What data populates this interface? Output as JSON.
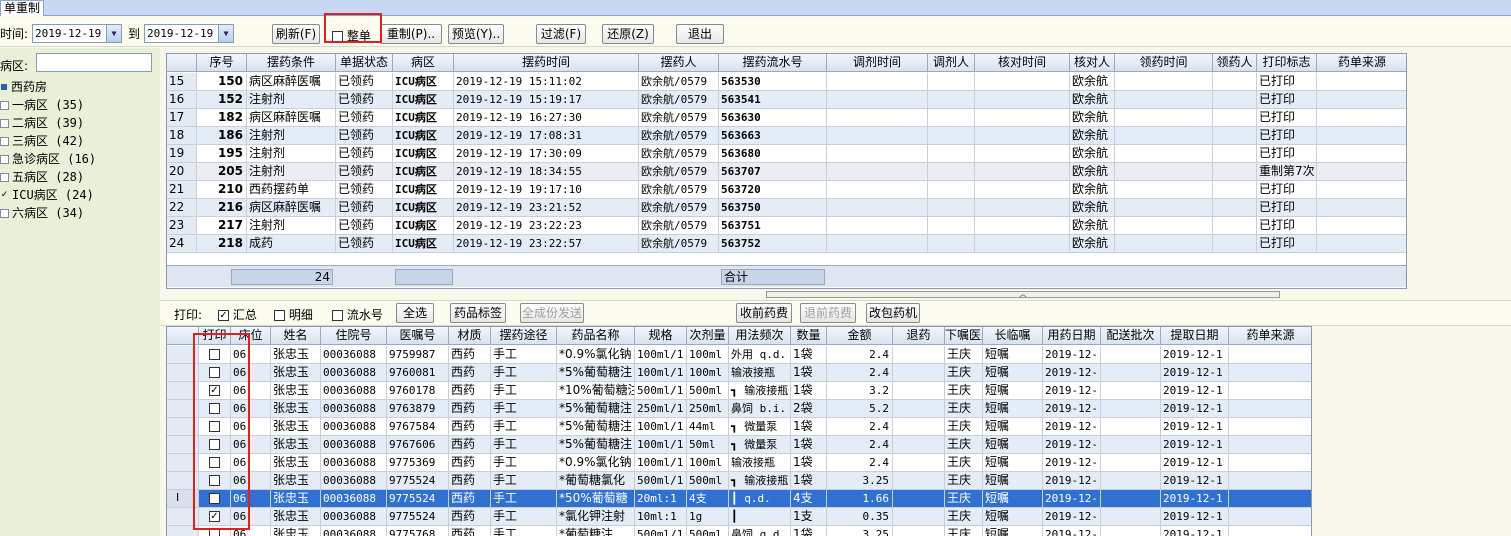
{
  "window": {
    "title": "单重制"
  },
  "toolbar": {
    "time_label": "时间:",
    "date_from": "2019-12-19",
    "to_label": "到",
    "date_to": "2019-12-19",
    "refresh": "刷新(F)",
    "whole_label": "整单",
    "whole_checked": false,
    "reprint": "重制(P)..",
    "preview": "预览(Y)..",
    "filter": "过滤(F)",
    "restore": "还原(Z)",
    "exit": "退出"
  },
  "left": {
    "ward_label": "病区:",
    "ward_value": "",
    "root": "西药房",
    "items": [
      {
        "label": "一病区 (35)",
        "checked": false
      },
      {
        "label": "二病区 (39)",
        "checked": false
      },
      {
        "label": "三病区 (42)",
        "checked": false
      },
      {
        "label": "急诊病区 (16)",
        "checked": false
      },
      {
        "label": "五病区 (28)",
        "checked": false
      },
      {
        "label": "ICU病区 (24)",
        "checked": true
      },
      {
        "label": "六病区 (34)",
        "checked": false
      }
    ]
  },
  "top_grid": {
    "headers": [
      "序号",
      "摆药条件",
      "单据状态",
      "病区",
      "摆药时间",
      "摆药人",
      "摆药流水号",
      "调剂时间",
      "调剂人",
      "核对时间",
      "核对人",
      "领药时间",
      "领药人",
      "打印标志",
      "药单来源"
    ],
    "rows": [
      {
        "idx": "15",
        "seq": "150",
        "cond": "病区麻醉医嘱",
        "status": "已领药",
        "ward": "ICU病区",
        "time": "2019-12-19 15:11:02",
        "person": "欧余航/0579",
        "serial": "563530",
        "checker": "欧余航",
        "flag": "已打印"
      },
      {
        "idx": "16",
        "seq": "152",
        "cond": "注射剂",
        "status": "已领药",
        "ward": "ICU病区",
        "time": "2019-12-19 15:19:17",
        "person": "欧余航/0579",
        "serial": "563541",
        "checker": "欧余航",
        "flag": "已打印"
      },
      {
        "idx": "17",
        "seq": "182",
        "cond": "病区麻醉医嘱",
        "status": "已领药",
        "ward": "ICU病区",
        "time": "2019-12-19 16:27:30",
        "person": "欧余航/0579",
        "serial": "563630",
        "checker": "欧余航",
        "flag": "已打印"
      },
      {
        "idx": "18",
        "seq": "186",
        "cond": "注射剂",
        "status": "已领药",
        "ward": "ICU病区",
        "time": "2019-12-19 17:08:31",
        "person": "欧余航/0579",
        "serial": "563663",
        "checker": "欧余航",
        "flag": "已打印"
      },
      {
        "idx": "19",
        "seq": "195",
        "cond": "注射剂",
        "status": "已领药",
        "ward": "ICU病区",
        "time": "2019-12-19 17:30:09",
        "person": "欧余航/0579",
        "serial": "563680",
        "checker": "欧余航",
        "flag": "已打印"
      },
      {
        "idx": "20",
        "seq": "205",
        "cond": "注射剂",
        "status": "已领药",
        "ward": "ICU病区",
        "time": "2019-12-19 18:34:55",
        "person": "欧余航/0579",
        "serial": "563707",
        "checker": "欧余航",
        "flag": "重制第7次"
      },
      {
        "idx": "21",
        "seq": "210",
        "cond": "西药摆药单",
        "status": "已领药",
        "ward": "ICU病区",
        "time": "2019-12-19 19:17:10",
        "person": "欧余航/0579",
        "serial": "563720",
        "checker": "欧余航",
        "flag": "已打印"
      },
      {
        "idx": "22",
        "seq": "216",
        "cond": "病区麻醉医嘱",
        "status": "已领药",
        "ward": "ICU病区",
        "time": "2019-12-19 23:21:52",
        "person": "欧余航/0579",
        "serial": "563750",
        "checker": "欧余航",
        "flag": "已打印"
      },
      {
        "idx": "23",
        "seq": "217",
        "cond": "注射剂",
        "status": "已领药",
        "ward": "ICU病区",
        "time": "2019-12-19 23:22:23",
        "person": "欧余航/0579",
        "serial": "563751",
        "checker": "欧余航",
        "flag": "已打印"
      },
      {
        "idx": "24",
        "seq": "218",
        "cond": "成药",
        "status": "已领药",
        "ward": "ICU病区",
        "time": "2019-12-19 23:22:57",
        "person": "欧余航/0579",
        "serial": "563752",
        "checker": "欧余航",
        "flag": "已打印"
      }
    ],
    "footer_count": "24",
    "footer_total": "合计"
  },
  "printbar": {
    "print_label": "打印:",
    "summary": "汇总",
    "summary_checked": true,
    "detail": "明细",
    "detail_checked": false,
    "serial": "流水号",
    "serial_checked": false,
    "select_all": "全选",
    "drug_label": "药品标签",
    "dispense_all": "全成份发送",
    "charge": "收前药费",
    "refund": "退前药费",
    "repack": "改包药机"
  },
  "bottom_grid": {
    "headers": [
      "打印",
      "床位",
      "姓名",
      "住院号",
      "医嘱号",
      "材质",
      "摆药途径",
      "药品名称",
      "规格",
      "次剂量",
      "用法频次",
      "数量",
      "金额",
      "退药",
      "下嘱医生",
      "长临嘱",
      "用药日期",
      "配送批次",
      "提取日期",
      "药单来源"
    ],
    "rows": [
      {
        "checked": false,
        "bed": "06",
        "name": "张忠玉",
        "inpatient": "00036088",
        "order": "9759987",
        "material": "西药",
        "route": "手工",
        "drug": "*0.9%氯化钠",
        "spec": "100ml/1",
        "dose": "100ml",
        "freq": "外用 q.d.",
        "qty": "1袋",
        "amount": "2.4",
        "doctor": "王庆",
        "type": "短嘱",
        "use_date": "2019-12-",
        "fetch_date": "2019-12-1"
      },
      {
        "checked": false,
        "bed": "06",
        "name": "张忠玉",
        "inpatient": "00036088",
        "order": "9760081",
        "material": "西药",
        "route": "手工",
        "drug": "*5%葡萄糖注",
        "spec": "100ml/1",
        "dose": "100ml",
        "freq": "输液接瓶",
        "qty": "1袋",
        "amount": "2.4",
        "doctor": "王庆",
        "type": "短嘱",
        "use_date": "2019-12-",
        "fetch_date": "2019-12-1"
      },
      {
        "checked": true,
        "bed": "06",
        "name": "张忠玉",
        "inpatient": "00036088",
        "order": "9760178",
        "material": "西药",
        "route": "手工",
        "drug": "*10%葡萄糖注",
        "spec": "500ml/1",
        "dose": "500ml",
        "freq": "┓ 输液接瓶",
        "qty": "1袋",
        "amount": "3.2",
        "doctor": "王庆",
        "type": "短嘱",
        "use_date": "2019-12-",
        "fetch_date": "2019-12-1"
      },
      {
        "checked": false,
        "bed": "06",
        "name": "张忠玉",
        "inpatient": "00036088",
        "order": "9763879",
        "material": "西药",
        "route": "手工",
        "drug": "*5%葡萄糖注",
        "spec": "250ml/1",
        "dose": "250ml",
        "freq": "鼻饲 b.i.",
        "qty": "2袋",
        "amount": "5.2",
        "doctor": "王庆",
        "type": "短嘱",
        "use_date": "2019-12-",
        "fetch_date": "2019-12-1"
      },
      {
        "checked": false,
        "bed": "06",
        "name": "张忠玉",
        "inpatient": "00036088",
        "order": "9767584",
        "material": "西药",
        "route": "手工",
        "drug": "*5%葡萄糖注",
        "spec": "100ml/1",
        "dose": "44ml",
        "freq": "┓ 微量泵",
        "qty": "1袋",
        "amount": "2.4",
        "doctor": "王庆",
        "type": "短嘱",
        "use_date": "2019-12-",
        "fetch_date": "2019-12-1"
      },
      {
        "checked": false,
        "bed": "06",
        "name": "张忠玉",
        "inpatient": "00036088",
        "order": "9767606",
        "material": "西药",
        "route": "手工",
        "drug": "*5%葡萄糖注",
        "spec": "100ml/1",
        "dose": "50ml",
        "freq": "┓ 微量泵",
        "qty": "1袋",
        "amount": "2.4",
        "doctor": "王庆",
        "type": "短嘱",
        "use_date": "2019-12-",
        "fetch_date": "2019-12-1"
      },
      {
        "checked": false,
        "bed": "06",
        "name": "张忠玉",
        "inpatient": "00036088",
        "order": "9775369",
        "material": "西药",
        "route": "手工",
        "drug": "*0.9%氯化钠",
        "spec": "100ml/1",
        "dose": "100ml",
        "freq": "输液接瓶",
        "qty": "1袋",
        "amount": "2.4",
        "doctor": "王庆",
        "type": "短嘱",
        "use_date": "2019-12-",
        "fetch_date": "2019-12-1"
      },
      {
        "checked": false,
        "bed": "06",
        "name": "张忠玉",
        "inpatient": "00036088",
        "order": "9775524",
        "material": "西药",
        "route": "手工",
        "drug": "*葡萄糖氯化",
        "spec": "500ml/1",
        "dose": "500ml",
        "freq": "┓ 输液接瓶",
        "qty": "1袋",
        "amount": "3.25",
        "doctor": "王庆",
        "type": "短嘱",
        "use_date": "2019-12-",
        "fetch_date": "2019-12-1"
      },
      {
        "checked": true,
        "selected": true,
        "bed": "06",
        "name": "张忠玉",
        "inpatient": "00036088",
        "order": "9775524",
        "material": "西药",
        "route": "手工",
        "drug": "*50%葡萄糖",
        "spec": "20ml:1",
        "dose": "4支",
        "freq": "┃ q.d.",
        "qty": "4支",
        "amount": "1.66",
        "doctor": "王庆",
        "type": "短嘱",
        "use_date": "2019-12-",
        "fetch_date": "2019-12-1"
      },
      {
        "checked": true,
        "bed": "06",
        "name": "张忠玉",
        "inpatient": "00036088",
        "order": "9775524",
        "material": "西药",
        "route": "手工",
        "drug": "*氯化钾注射",
        "spec": "10ml:1",
        "dose": "1g",
        "freq": "┃",
        "qty": "1支",
        "amount": "0.35",
        "doctor": "王庆",
        "type": "短嘱",
        "use_date": "2019-12-",
        "fetch_date": "2019-12-1"
      },
      {
        "checked": false,
        "bed": "06",
        "name": "张忠玉",
        "inpatient": "00036088",
        "order": "9775768",
        "material": "西药",
        "route": "手工",
        "drug": "*葡萄糖注",
        "spec": "500ml/1",
        "dose": "500ml",
        "freq": "鼻饲 q.d.",
        "qty": "1袋",
        "amount": "3.25",
        "doctor": "王庆",
        "type": "短嘱",
        "use_date": "2019-12-",
        "fetch_date": "2019-12-1"
      }
    ]
  },
  "colors": {
    "highlight": "#3070d0",
    "redbox": "#e02020"
  }
}
